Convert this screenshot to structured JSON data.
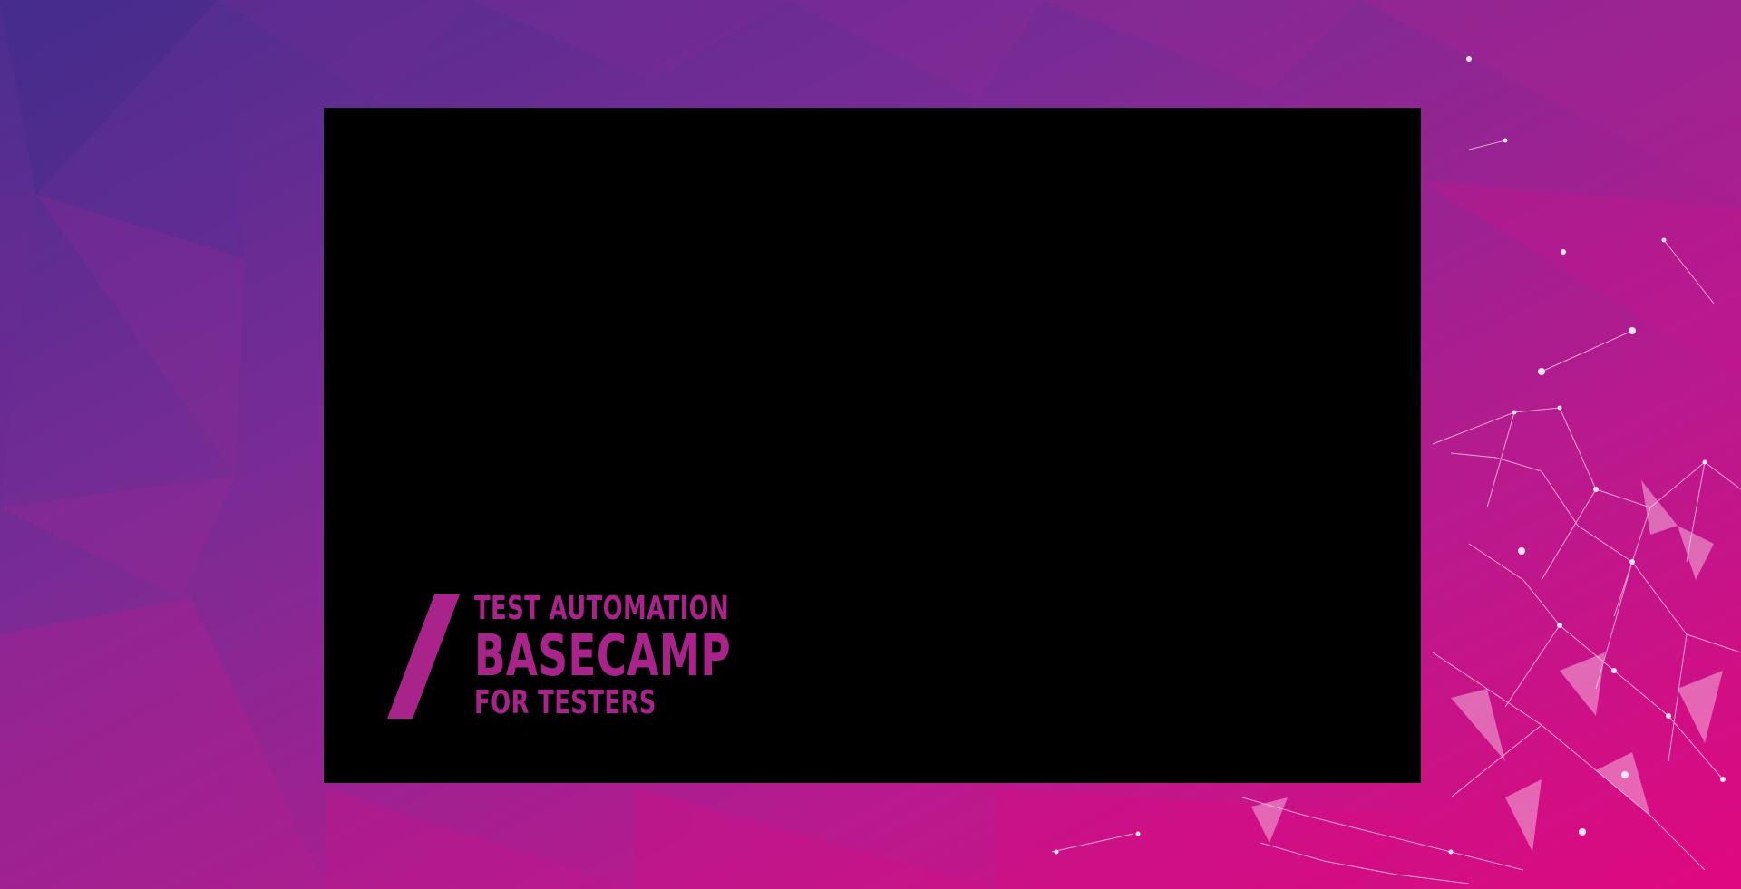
{
  "background": {
    "colors": {
      "top_left": "#4a2e8f",
      "mid": "#8f2a97",
      "bottom_right": "#e0087f",
      "network_lines": "#ffd3ee"
    }
  },
  "video_player": {
    "state": "black frame",
    "background_color": "#000000"
  },
  "logo": {
    "icon": "slash-icon",
    "line1": "TEST AUTOMATION",
    "line2": "BASECAMP",
    "line3": "FOR TESTERS",
    "color": "#a8238a"
  }
}
